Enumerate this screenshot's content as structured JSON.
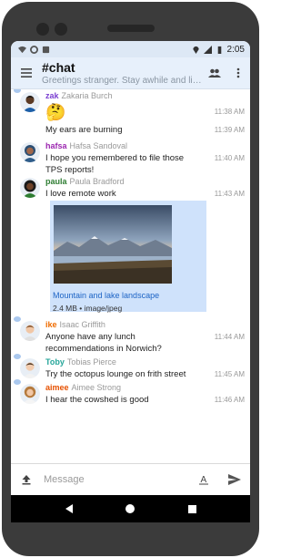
{
  "status_bar": {
    "time": "2:05",
    "icons": [
      "wifi-icon",
      "sync-icon",
      "sim-icon",
      "location-icon",
      "lte-icon",
      "battery-icon"
    ]
  },
  "channel": {
    "title": "#chat",
    "subtitle": "Greetings stranger. Stay awhile and listen."
  },
  "messages": [
    {
      "username": "zak",
      "realname": "Zakaria Burch",
      "user_color": "#7b3fd1",
      "text": "",
      "emoji": "🤔",
      "time": "11:38 AM"
    },
    {
      "username": "",
      "realname": "",
      "user_color": "#222222",
      "text": "My ears are burning",
      "time": "11:39 AM"
    },
    {
      "username": "hafsa",
      "realname": "Hafsa Sandoval",
      "user_color": "#9c27b0",
      "text": "I hope you remembered to file those TPS reports!",
      "time": "11:40 AM"
    },
    {
      "username": "paula",
      "realname": "Paula Bradford",
      "user_color": "#2e7d32",
      "text": "I love remote work",
      "time": "11:43 AM"
    },
    {
      "username": "ike",
      "realname": "Isaac Griffith",
      "user_color": "#ef6c00",
      "text": "Anyone have any lunch recommendations in Norwich?",
      "time": "11:44 AM"
    },
    {
      "username": "Toby",
      "realname": "Tobias Pierce",
      "user_color": "#26a69a",
      "text": "Try the octopus lounge on frith street",
      "time": "11:45 AM"
    },
    {
      "username": "aimee",
      "realname": "Aimee Strong",
      "user_color": "#e65100",
      "text": "I hear the cowshed is good",
      "time": "11:46 AM"
    }
  ],
  "attachment": {
    "title": "Mountain and lake landscape",
    "size": "2.4 MB",
    "mime": "image/jpeg",
    "meta": "2.4 MB • image/jpeg"
  },
  "composer": {
    "placeholder": "Message"
  },
  "colors": {
    "app_bar": "#e7f0fb",
    "link": "#1d64c5",
    "attachment_bg": "#cfe2fb"
  }
}
